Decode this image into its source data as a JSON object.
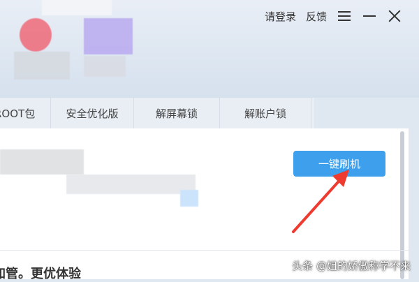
{
  "header": {
    "login_label": "请登录",
    "feedback_label": "反馈"
  },
  "tabs": [
    "ROOT包",
    "安全优化版",
    "解屏幕锁",
    "解账户锁"
  ],
  "main": {
    "flash_button_label": "一键刷机",
    "bottom_title": "加管。更优体验"
  },
  "watermark": "头条 @姐的娇傲称学不来",
  "colors": {
    "accent_blue": "#3ea0ec",
    "arrow_red": "#ee3a2f",
    "header_bg": "#e3eaf3"
  }
}
